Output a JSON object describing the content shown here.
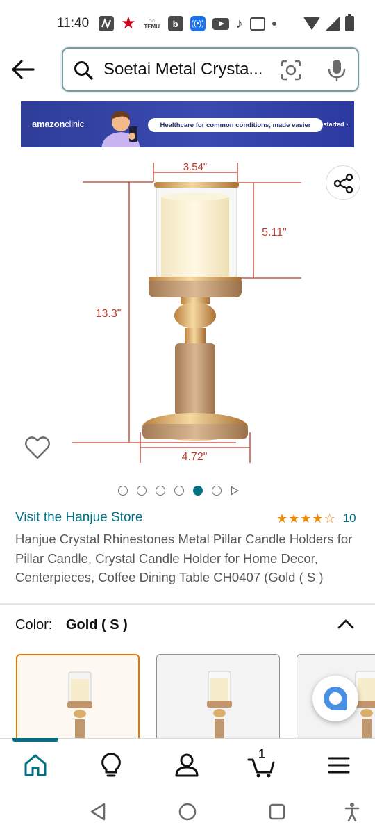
{
  "status_bar": {
    "time": "11:40",
    "icons": [
      "n-app-icon",
      "star-icon",
      "temu-icon",
      "b-app-icon",
      "broadcast-icon",
      "youtube-icon",
      "tiktok-icon",
      "news-icon",
      "dot-icon",
      "wifi-icon",
      "signal-icon",
      "battery-icon"
    ],
    "temu_label": "TEMU",
    "b_label": "b"
  },
  "search": {
    "query": "Soetai Metal Crysta...",
    "icons": [
      "back-arrow-icon",
      "search-icon",
      "camera-lens-icon",
      "mic-icon"
    ]
  },
  "ad": {
    "brand": "amazon",
    "brand_suffix": "clinic",
    "headline": "Healthcare for common conditions, made easier",
    "cta": "Get started ›"
  },
  "product_image": {
    "dim_width_top": "3.54\"",
    "dim_height_glass": "5.11\"",
    "dim_height_total": "13.3\"",
    "dim_width_base": "4.72\"",
    "dots_total": 6,
    "active_dot_index": 4
  },
  "product": {
    "store_link": "Visit the Hanjue Store",
    "rating": 4.5,
    "rating_count": "10",
    "title": "Hanjue Crystal Rhinestones Metal Pillar Candle Holders for Pillar Candle, Crystal Candle Holder for Home Decor, Centerpieces, Coffee Dining Table CH0407 (Gold ( S )"
  },
  "variation": {
    "label": "Color:",
    "value": "Gold ( S )",
    "selected_swatch": 0
  },
  "bottom_nav": {
    "items": [
      "home-icon",
      "inspire-bulb-icon",
      "account-icon",
      "cart-icon",
      "menu-icon"
    ],
    "cart_count": "1",
    "active": "home"
  },
  "colors": {
    "link": "#007185",
    "star": "#f08804",
    "selected_border": "#e77600",
    "dimension_red": "#c0392b"
  }
}
